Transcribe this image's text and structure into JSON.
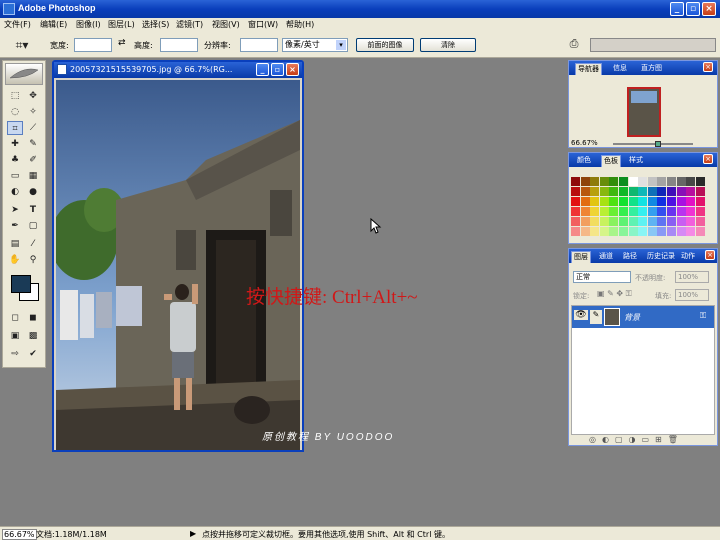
{
  "app": {
    "title": "Adobe Photoshop"
  },
  "menu": [
    "文件(F)",
    "编辑(E)",
    "图像(I)",
    "图层(L)",
    "选择(S)",
    "滤镜(T)",
    "视图(V)",
    "窗口(W)",
    "帮助(H)"
  ],
  "options": {
    "width_label": "宽度:",
    "height_label": "高度:",
    "resolution_label": "分辨率:",
    "unit": "像素/英寸",
    "front_image_button": "前面的图像",
    "clear_button": "清除"
  },
  "document": {
    "title": "200573215155397​05.jpg @ 66.7%(RG..."
  },
  "overlay": {
    "shortcut_text": "按快捷键: Ctrl+Alt+~",
    "credit": "原创教程  BY  UOODOO"
  },
  "navigator": {
    "tabs": [
      "导航器",
      "信息",
      "直方图"
    ],
    "zoom": "66.67%"
  },
  "color_panel": {
    "tabs": [
      "颜色",
      "色板",
      "样式"
    ]
  },
  "layers": {
    "tabs": [
      "图层",
      "通道",
      "路径",
      "历史记录",
      "动作"
    ],
    "blend_mode": "正常",
    "opacity_label": "不透明度:",
    "opacity_value": "100%",
    "lock_label": "锁定:",
    "fill_label": "填充:",
    "fill_value": "100%",
    "items": [
      {
        "name": "背景"
      }
    ]
  },
  "status": {
    "zoom": "66.67%",
    "doc_size": "文档:1.18M/1.18M",
    "hint": "点按并拖移可定义裁切框。要用其他选项,使用 Shift、Alt 和 Ctrl 键。"
  },
  "colors": {
    "accent": "#0a3fbc",
    "overlay_text": "#d01818",
    "foreground_color": "#1a3a56"
  }
}
